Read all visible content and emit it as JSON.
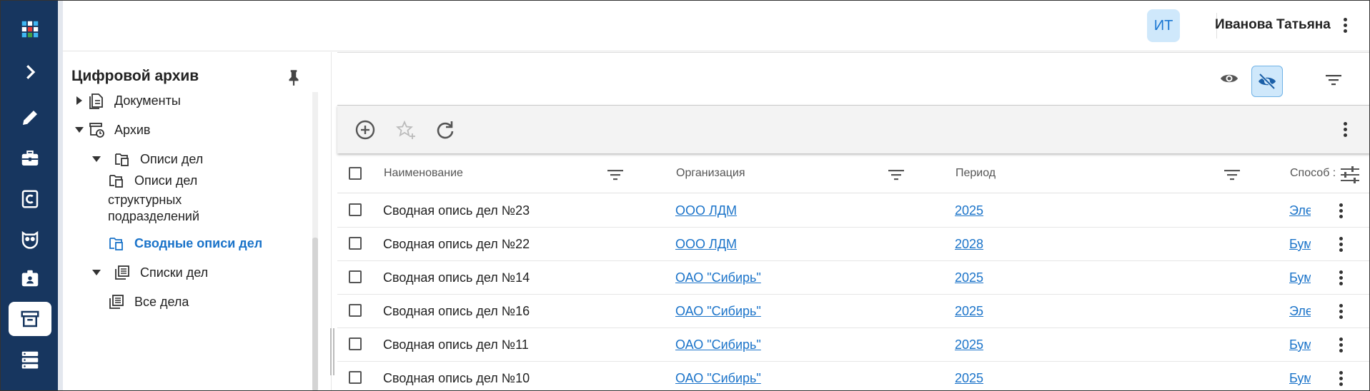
{
  "header": {
    "avatar_initials": "ИТ",
    "user_name": "Иванова Татьяна"
  },
  "rail": {
    "icons": [
      "apps-grid-icon",
      "expand-chevron-icon",
      "edit-pencil-icon",
      "toolbox-icon",
      "c-letter-icon",
      "owl-icon",
      "badge-icon",
      "archive-box-icon",
      "storage-icon"
    ],
    "active": "archive-box-icon"
  },
  "sidebar": {
    "title": "Цифровой архив",
    "tree": {
      "documents": "Документы",
      "archive": "Архив",
      "inventories": "Описи дел",
      "dept_inventories": [
        "Описи дел",
        "структурных",
        "подразделений"
      ],
      "summary_inventories": "Сводные описи дел",
      "case_lists": "Списки дел",
      "all_cases": "Все дела"
    }
  },
  "table": {
    "columns": {
      "name": "Наименование",
      "organization": "Организация",
      "period": "Период",
      "method": "Способ :"
    },
    "rows": [
      {
        "name": "Сводная опись дел №23",
        "organization": "ООО ЛДМ",
        "period": "2025",
        "method": "Электронный"
      },
      {
        "name": "Сводная опись дел №22",
        "organization": "ООО ЛДМ",
        "period": "2028",
        "method": "Бумажный"
      },
      {
        "name": "Сводная опись дел №14",
        "organization": "ОАО \"Сибирь\"",
        "period": "2025",
        "method": "Бумажный"
      },
      {
        "name": "Сводная опись дел №16",
        "organization": "ОАО \"Сибирь\"",
        "period": "2025",
        "method": "Электронный"
      },
      {
        "name": "Сводная опись дел №11",
        "organization": "ОАО \"Сибирь\"",
        "period": "2025",
        "method": "Бумажный"
      },
      {
        "name": "Сводная опись дел №10",
        "organization": "ОАО \"Сибирь\"",
        "period": "2025",
        "method": "Бумажный"
      }
    ]
  },
  "colors": {
    "rail_bg": "#17365f",
    "accent": "#1a73c9",
    "active_toggle_bg": "#cfe8fb"
  }
}
